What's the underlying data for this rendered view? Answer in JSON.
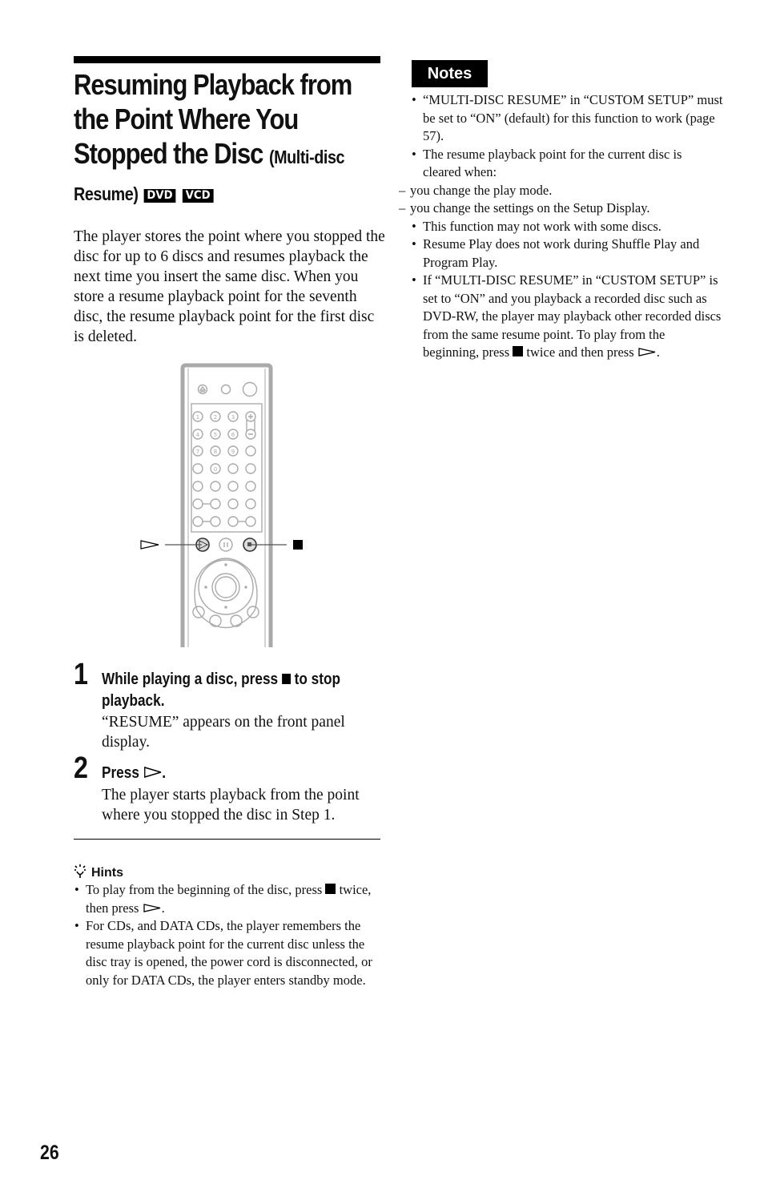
{
  "title": {
    "line1": "Resuming Playback from",
    "line2": "the Point Where You",
    "line3": "Stopped the Disc",
    "subtitle_a": "(Multi-disc",
    "subtitle_b": "Resume)",
    "badges": [
      "DVD",
      "VCD"
    ]
  },
  "intro": "The player stores the point where you stopped the disc for up to 6 discs and resumes playback the next time you insert the same disc. When you store a resume playback point for the seventh disc, the resume playback point for the first disc is deleted.",
  "illustration": {
    "subject": "remote-control",
    "callouts": [
      "play-icon",
      "stop-icon"
    ],
    "number_keys": [
      "1",
      "2",
      "3",
      "4",
      "5",
      "6",
      "7",
      "8",
      "9",
      "0"
    ]
  },
  "steps": [
    {
      "number": "1",
      "heading_a": "While playing a disc, press",
      "heading_b": "to stop playback.",
      "body": "“RESUME” appears on the front panel display."
    },
    {
      "number": "2",
      "heading_a": "Press",
      "heading_b": ".",
      "body": "The player starts playback from the point where you stopped the disc in Step 1."
    }
  ],
  "hints": {
    "heading": "Hints",
    "items": [
      {
        "a": "To play from the beginning of the disc, press",
        "b": "twice, then press",
        "c": "."
      },
      {
        "text": "For CDs, and DATA CDs, the player remembers the resume playback point for the current disc unless the disc tray is opened, the power cord is disconnected, or only for DATA CDs, the player enters standby mode."
      }
    ]
  },
  "notes": {
    "heading": "Notes",
    "items": [
      {
        "type": "bullet",
        "text": "“MULTI-DISC RESUME” in “CUSTOM SETUP” must be set to “ON” (default) for this function to work (page 57)."
      },
      {
        "type": "bullet",
        "text": "The resume playback point for the current disc is cleared when:"
      },
      {
        "type": "dash",
        "text": "you change the play mode."
      },
      {
        "type": "dash",
        "text": "you change the settings on the Setup Display."
      },
      {
        "type": "bullet",
        "text": "This function may not work with some discs."
      },
      {
        "type": "bullet",
        "text": "Resume Play does not work during Shuffle Play and Program Play."
      },
      {
        "type": "bullet",
        "text": "If “MULTI-DISC RESUME” in “CUSTOM SETUP” is set to “ON” and you playback a recorded disc such as DVD-RW, the player may playback other recorded discs from the same resume point. To play from the beginning, press",
        "tail_a": "twice and then press",
        "tail_b": "."
      }
    ]
  },
  "page_number": "26"
}
